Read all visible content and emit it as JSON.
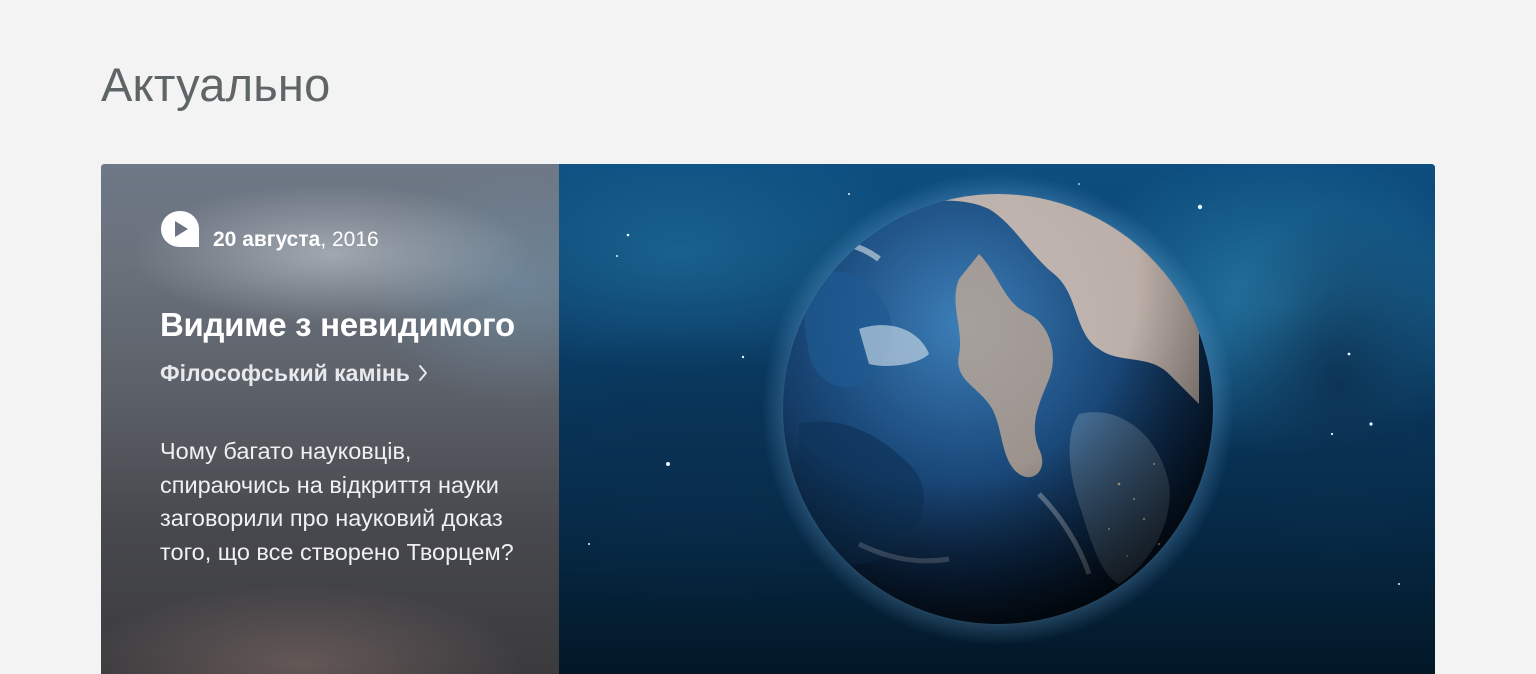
{
  "section": {
    "title": "Актуально"
  },
  "article": {
    "date_day": "20 августа",
    "date_rest": ", 2016",
    "title": "Видиме з невидимого",
    "category": "Філософський камінь",
    "description": "Чому багато науковців, спираючись на відкриття науки заговорили про науковий доказ того, що все створено Творцем?",
    "icons": {
      "logo": "play-logo-icon",
      "category_arrow": "chevron-right-icon"
    },
    "image": "earth-in-space"
  },
  "colors": {
    "page_background": "#f3f3f3",
    "title_text": "#5f6566",
    "card_text": "#ffffff"
  }
}
